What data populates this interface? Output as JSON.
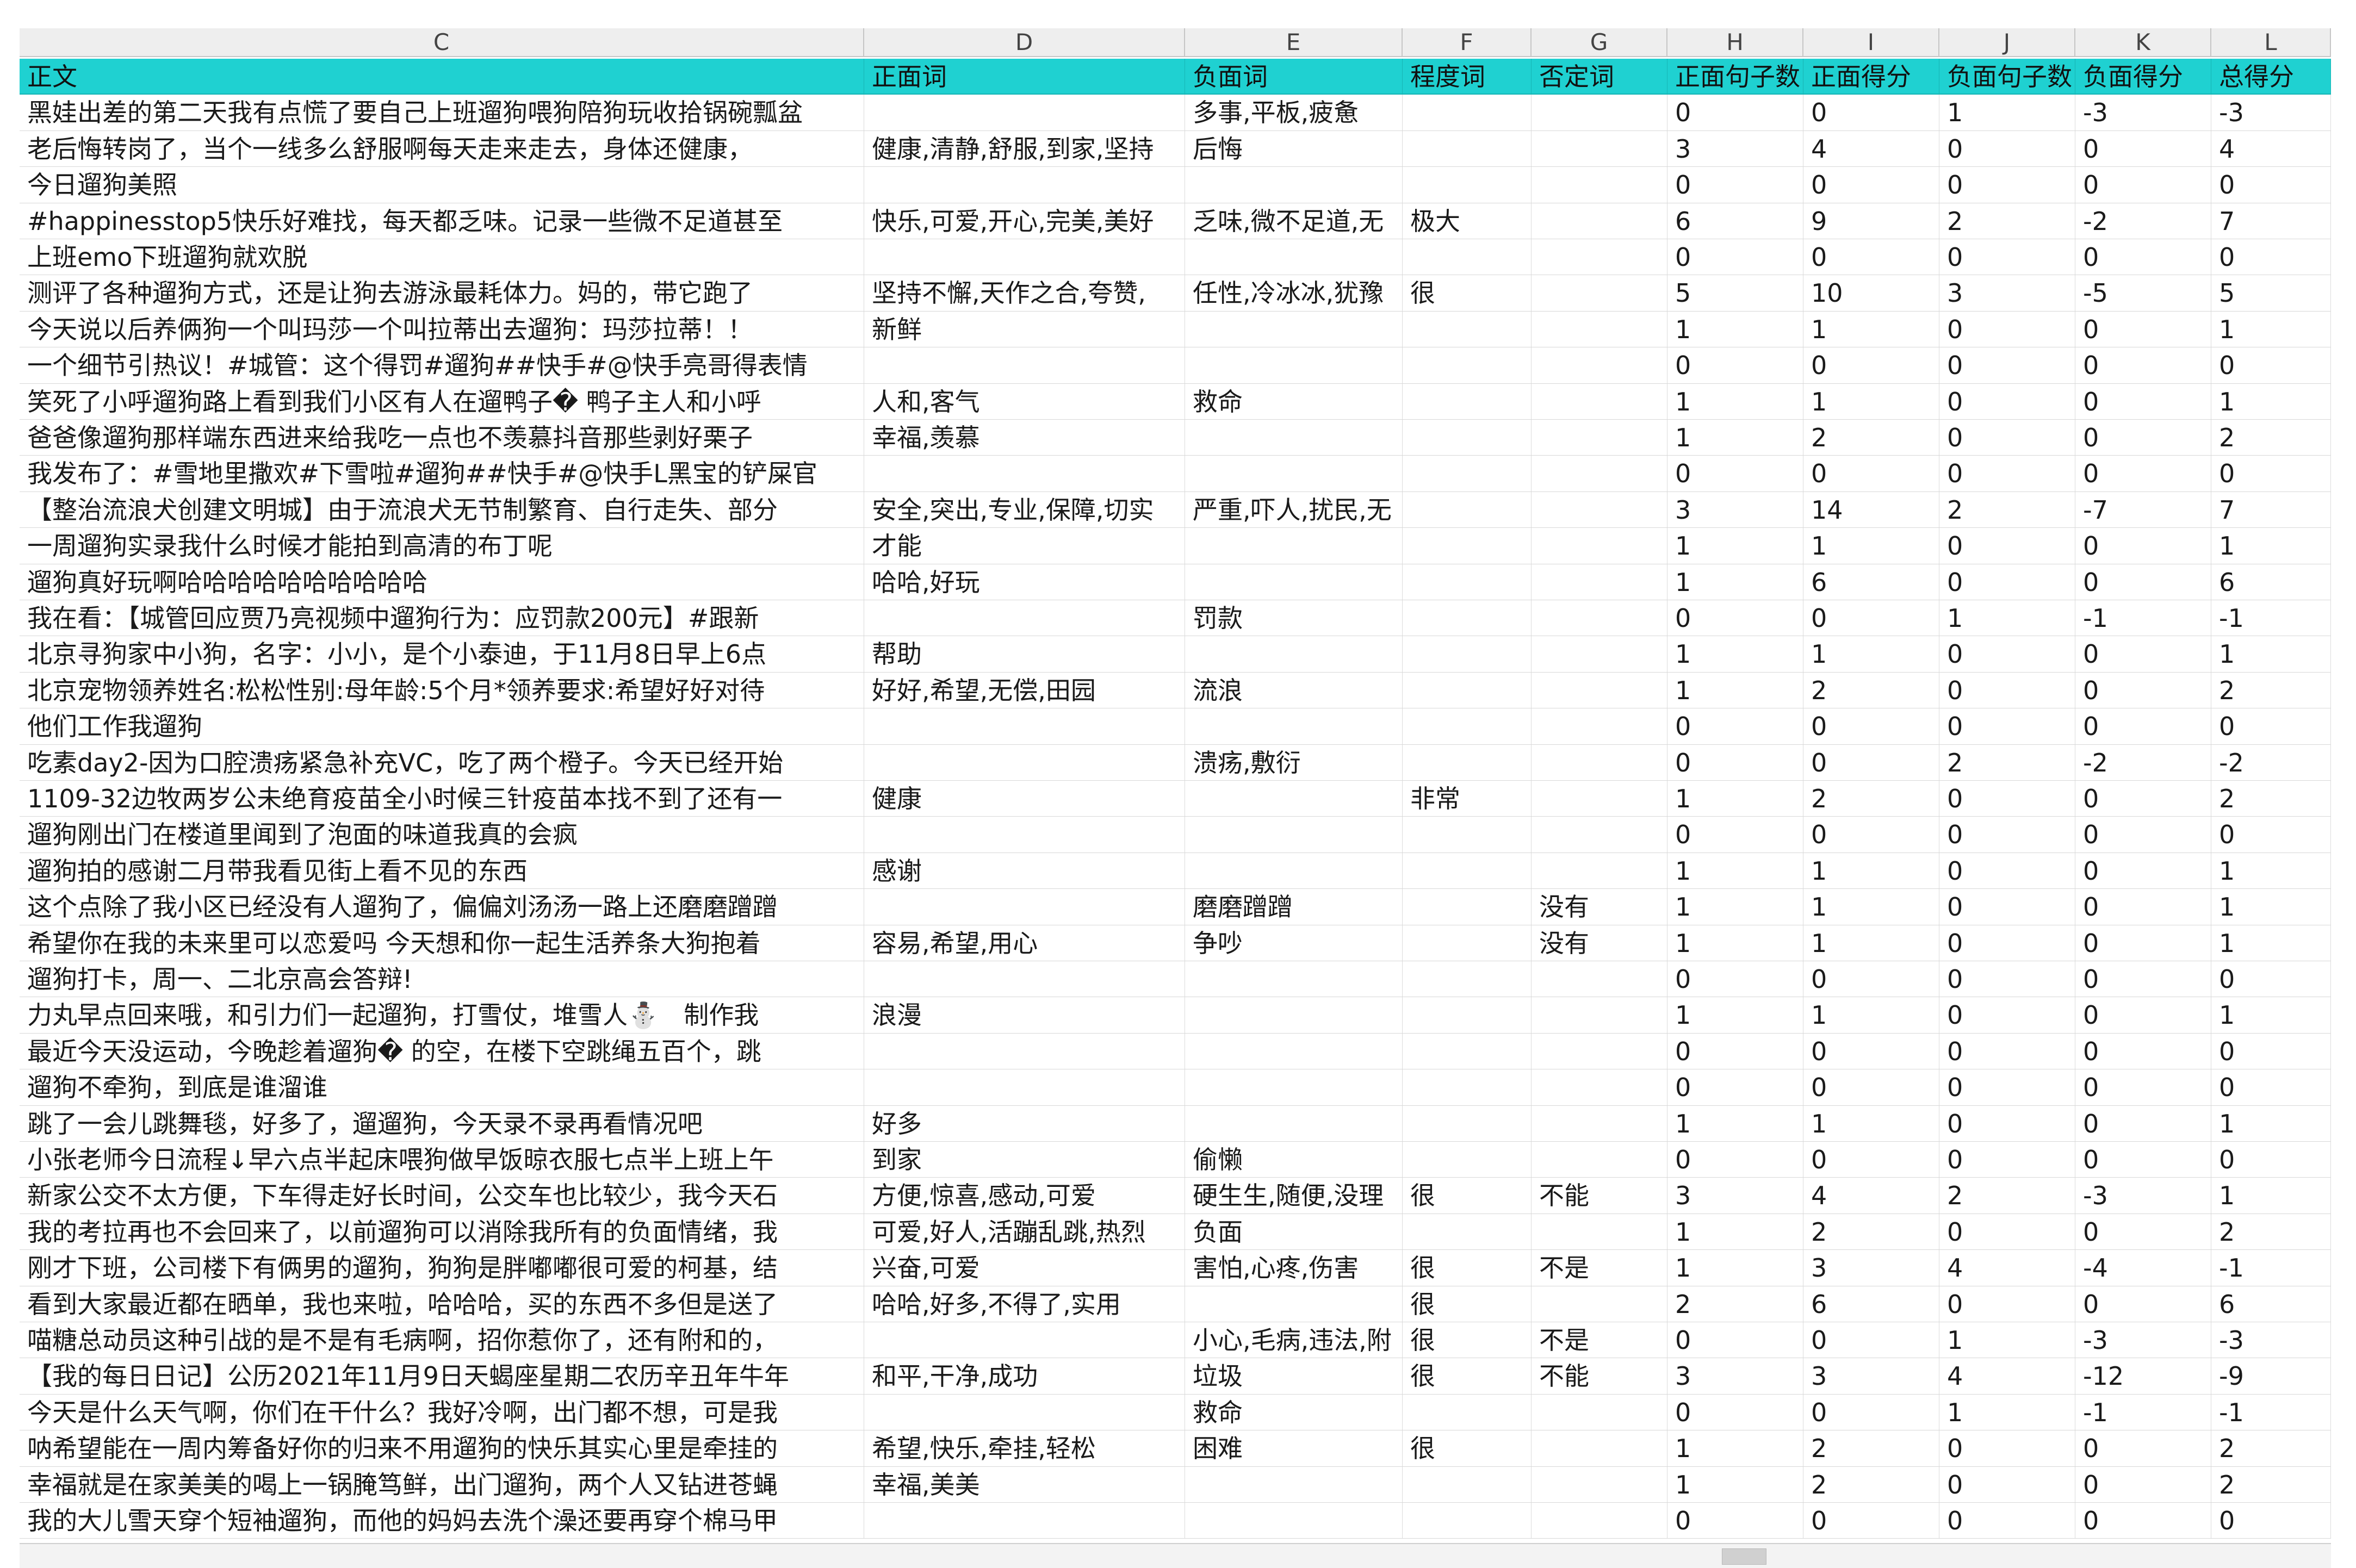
{
  "columns": [
    "C",
    "D",
    "E",
    "F",
    "G",
    "H",
    "I",
    "J",
    "K",
    "L"
  ],
  "header": [
    "正文",
    "正面词",
    "负面词",
    "程度词",
    "否定词",
    "正面句子数",
    "正面得分",
    "负面句子数",
    "负面得分",
    "总得分"
  ],
  "rows": [
    [
      "黑娃出差的第二天我有点慌了要自己上班遛狗喂狗陪狗玩收拾锅碗瓢盆",
      "",
      "多事,平板,疲惫",
      "",
      "",
      "0",
      "0",
      "1",
      "-3",
      "-3"
    ],
    [
      "老后悔转岗了，当个一线多么舒服啊每天走来走去，身体还健康，",
      "健康,清静,舒服,到家,坚持",
      "后悔",
      "",
      "",
      "3",
      "4",
      "0",
      "0",
      "4"
    ],
    [
      "今日遛狗美照",
      "",
      "",
      "",
      "",
      "0",
      "0",
      "0",
      "0",
      "0"
    ],
    [
      "#happinesstop5快乐好难找，每天都乏味。记录一些微不足道甚至",
      "快乐,可爱,开心,完美,美好",
      "乏味,微不足道,无",
      "极大",
      "",
      "6",
      "9",
      "2",
      "-2",
      "7"
    ],
    [
      "上班emo下班遛狗就欢脱",
      "",
      "",
      "",
      "",
      "0",
      "0",
      "0",
      "0",
      "0"
    ],
    [
      "测评了各种遛狗方式，还是让狗去游泳最耗体力。妈的，带它跑了",
      "坚持不懈,天作之合,夸赞,",
      "任性,冷冰冰,犹豫",
      "很",
      "",
      "5",
      "10",
      "3",
      "-5",
      "5"
    ],
    [
      "今天说以后养俩狗一个叫玛莎一个叫拉蒂出去遛狗：玛莎拉蒂！！",
      "新鲜",
      "",
      "",
      "",
      "1",
      "1",
      "0",
      "0",
      "1"
    ],
    [
      "一个细节引热议！#城管：这个得罚#遛狗##快手#@快手亮哥得表情",
      "",
      "",
      "",
      "",
      "0",
      "0",
      "0",
      "0",
      "0"
    ],
    [
      "笑死了小呼遛狗路上看到我们小区有人在遛鸭子� 鸭子主人和小呼",
      "人和,客气",
      "救命",
      "",
      "",
      "1",
      "1",
      "0",
      "0",
      "1"
    ],
    [
      "爸爸像遛狗那样端东西进来给我吃一点也不羡慕抖音那些剥好栗子",
      "幸福,羡慕",
      "",
      "",
      "",
      "1",
      "2",
      "0",
      "0",
      "2"
    ],
    [
      "我发布了：#雪地里撒欢#下雪啦#遛狗##快手#@快手L黑宝的铲屎官",
      "",
      "",
      "",
      "",
      "0",
      "0",
      "0",
      "0",
      "0"
    ],
    [
      "【整治流浪犬创建文明城】由于流浪犬无节制繁育、自行走失、部分",
      "安全,突出,专业,保障,切实",
      "严重,吓人,扰民,无",
      "",
      "",
      "3",
      "14",
      "2",
      "-7",
      "7"
    ],
    [
      "一周遛狗实录我什么时候才能拍到高清的布丁呢",
      "才能",
      "",
      "",
      "",
      "1",
      "1",
      "0",
      "0",
      "1"
    ],
    [
      "遛狗真好玩啊哈哈哈哈哈哈哈哈哈哈",
      "哈哈,好玩",
      "",
      "",
      "",
      "1",
      "6",
      "0",
      "0",
      "6"
    ],
    [
      "我在看：【城管回应贾乃亮视频中遛狗行为：应罚款200元】#跟新",
      "",
      "罚款",
      "",
      "",
      "0",
      "0",
      "1",
      "-1",
      "-1"
    ],
    [
      "北京寻狗家中小狗，名字：小小，是个小泰迪，于11月8日早上6点",
      "帮助",
      "",
      "",
      "",
      "1",
      "1",
      "0",
      "0",
      "1"
    ],
    [
      "北京宠物领养姓名:松松性别:母年龄:5个月*领养要求:希望好好对待",
      "好好,希望,无偿,田园",
      "流浪",
      "",
      "",
      "1",
      "2",
      "0",
      "0",
      "2"
    ],
    [
      "他们工作我遛狗",
      "",
      "",
      "",
      "",
      "0",
      "0",
      "0",
      "0",
      "0"
    ],
    [
      "吃素day2-因为口腔溃疡紧急补充VC，吃了两个橙子。今天已经开始",
      "",
      "溃疡,敷衍",
      "",
      "",
      "0",
      "0",
      "2",
      "-2",
      "-2"
    ],
    [
      "1109-32边牧两岁公未绝育疫苗全小时候三针疫苗本找不到了还有一",
      "健康",
      "",
      "非常",
      "",
      "1",
      "2",
      "0",
      "0",
      "2"
    ],
    [
      "遛狗刚出门在楼道里闻到了泡面的味道我真的会疯",
      "",
      "",
      "",
      "",
      "0",
      "0",
      "0",
      "0",
      "0"
    ],
    [
      "遛狗拍的感谢二月带我看见街上看不见的东西",
      "感谢",
      "",
      "",
      "",
      "1",
      "1",
      "0",
      "0",
      "1"
    ],
    [
      "这个点除了我小区已经没有人遛狗了，偏偏刘汤汤一路上还磨磨蹭蹭",
      "",
      "磨磨蹭蹭",
      "",
      "没有",
      "1",
      "1",
      "0",
      "0",
      "1"
    ],
    [
      "希望你在我的未来里可以恋爱吗 今天想和你一起生活养条大狗抱着",
      "容易,希望,用心",
      "争吵",
      "",
      "没有",
      "1",
      "1",
      "0",
      "0",
      "1"
    ],
    [
      "遛狗打卡，周一、二北京高会答辩!",
      "",
      "",
      "",
      "",
      "0",
      "0",
      "0",
      "0",
      "0"
    ],
    [
      "力丸早点回来哦，和引力们一起遛狗，打雪仗，堆雪人⛄　制作我",
      "浪漫",
      "",
      "",
      "",
      "1",
      "1",
      "0",
      "0",
      "1"
    ],
    [
      "最近今天没运动，今晚趁着遛狗� 的空，在楼下空跳绳五百个，跳",
      "",
      "",
      "",
      "",
      "0",
      "0",
      "0",
      "0",
      "0"
    ],
    [
      "遛狗不牵狗，到底是谁溜谁",
      "",
      "",
      "",
      "",
      "0",
      "0",
      "0",
      "0",
      "0"
    ],
    [
      "跳了一会儿跳舞毯，好多了，遛遛狗，今天录不录再看情况吧",
      "好多",
      "",
      "",
      "",
      "1",
      "1",
      "0",
      "0",
      "1"
    ],
    [
      "小张老师今日流程↓早六点半起床喂狗做早饭晾衣服七点半上班上午",
      "到家",
      "偷懒",
      "",
      "",
      "0",
      "0",
      "0",
      "0",
      "0"
    ],
    [
      "新家公交不太方便，下车得走好长时间，公交车也比较少，我今天石",
      "方便,惊喜,感动,可爱",
      "硬生生,随便,没理",
      "很",
      "不能",
      "3",
      "4",
      "2",
      "-3",
      "1"
    ],
    [
      "我的考拉再也不会回来了，以前遛狗可以消除我所有的负面情绪，我",
      "可爱,好人,活蹦乱跳,热烈",
      "负面",
      "",
      "",
      "1",
      "2",
      "0",
      "0",
      "2"
    ],
    [
      "刚才下班，公司楼下有俩男的遛狗，狗狗是胖嘟嘟很可爱的柯基，结",
      "兴奋,可爱",
      "害怕,心疼,伤害",
      "很",
      "不是",
      "1",
      "3",
      "4",
      "-4",
      "-1"
    ],
    [
      "看到大家最近都在晒单，我也来啦，哈哈哈，买的东西不多但是送了",
      "哈哈,好多,不得了,实用",
      "",
      "很",
      "",
      "2",
      "6",
      "0",
      "0",
      "6"
    ],
    [
      "喵糖总动员这种引战的是不是有毛病啊，招你惹你了，还有附和的，",
      "",
      "小心,毛病,违法,附",
      "很",
      "不是",
      "0",
      "0",
      "1",
      "-3",
      "-3"
    ],
    [
      "【我的每日日记】公历2021年11月9日天蝎座星期二农历辛丑年牛年",
      "和平,干净,成功",
      "垃圾",
      "很",
      "不能",
      "3",
      "3",
      "4",
      "-12",
      "-9"
    ],
    [
      "今天是什么天气啊，你们在干什么？我好冷啊，出门都不想，可是我",
      "",
      "救命",
      "",
      "",
      "0",
      "0",
      "1",
      "-1",
      "-1"
    ],
    [
      "呐希望能在一周内筹备好你的归来不用遛狗的快乐其实心里是牵挂的",
      "希望,快乐,牵挂,轻松",
      "困难",
      "很",
      "",
      "1",
      "2",
      "0",
      "0",
      "2"
    ],
    [
      "幸福就是在家美美的喝上一锅腌笃鲜，出门遛狗，两个人又钻进苍蝇",
      "幸福,美美",
      "",
      "",
      "",
      "1",
      "2",
      "0",
      "0",
      "2"
    ],
    [
      "我的大儿雪天穿个短袖遛狗，而他的妈妈去洗个澡还要再穿个棉马甲",
      "",
      "",
      "",
      "",
      "0",
      "0",
      "0",
      "0",
      "0"
    ]
  ]
}
